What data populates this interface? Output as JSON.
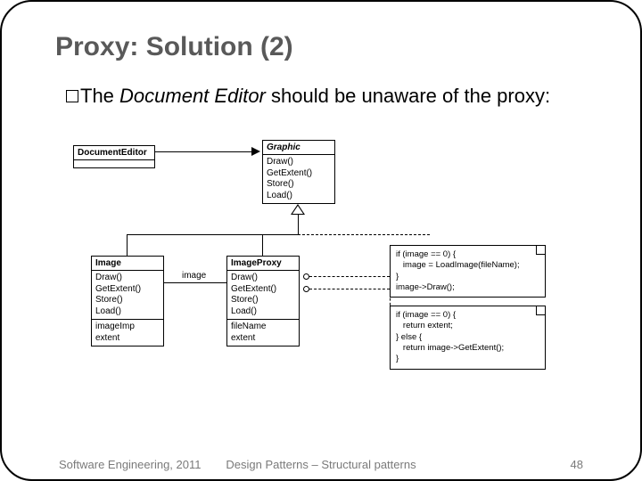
{
  "title": "Proxy: Solution (2)",
  "body": {
    "pre": "The ",
    "italic": "Document Editor",
    "post": " should be unaware of the proxy:"
  },
  "uml": {
    "docEditor": {
      "name": "DocumentEditor"
    },
    "graphic": {
      "name": "Graphic",
      "ops": [
        "Draw()",
        "GetExtent()",
        "Store()",
        "Load()"
      ]
    },
    "image": {
      "name": "Image",
      "ops": [
        "Draw()",
        "GetExtent()",
        "Store()",
        "Load()"
      ],
      "attrs": [
        "imageImp",
        "extent"
      ]
    },
    "imageProxy": {
      "name": "ImageProxy",
      "ops": [
        "Draw()",
        "GetExtent()",
        "Store()",
        "Load()"
      ],
      "attrs": [
        "fileName",
        "extent"
      ]
    },
    "assocLabel": "image",
    "note1": [
      "if (image == 0) {",
      "  image = LoadImage(fileName);",
      "}",
      "image->Draw();"
    ],
    "note2": [
      "if (image == 0) {",
      "  return extent;",
      "} else {",
      "  return image->GetExtent();",
      "}"
    ]
  },
  "footer": {
    "left": "Software Engineering, 2011",
    "center": "Design Patterns – Structural patterns",
    "right": "48"
  }
}
